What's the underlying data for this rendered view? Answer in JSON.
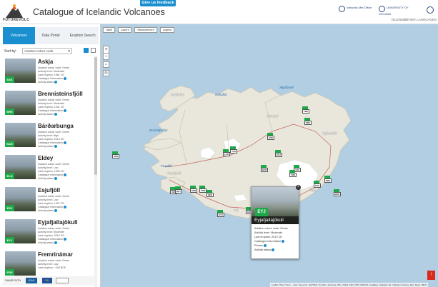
{
  "header": {
    "logo_text": "FUTUREVOLC",
    "title": "Catalogue of Icelandic Volcanoes",
    "feedback_label": "Give us feedback",
    "partner_1": "Icelandic Met Office",
    "partner_2": "UNIVERSITY OF ICELAND",
    "language": "ÍSLENSKA",
    "alt_view": "OTHER LANGUAGES"
  },
  "sidebar": {
    "tabs": [
      "Volcanoes",
      "Data Portal",
      "Eruption Search"
    ],
    "active_tab": "Volcanoes",
    "sort_label": "Sort by:",
    "sort_value": "Aviation colour code",
    "volcanoes": [
      {
        "name": "Askja",
        "code": "ASK",
        "lines": [
          "Aviation colour code: Green",
          "Activity level: Moderate",
          "Last eruption: 1961 CE",
          "Catalogue information",
          "Activity status"
        ]
      },
      {
        "name": "Brennisteinsfjöll",
        "code": "BRE",
        "lines": [
          "Aviation colour code: Green",
          "Activity level: Moderate",
          "Last eruption: 1341 CE",
          "Catalogue information",
          "Activity status"
        ]
      },
      {
        "name": "Bárðarbunga",
        "code": "BAR",
        "lines": [
          "Aviation colour code: Green",
          "Activity level: High",
          "Last eruption: 2014 CE",
          "Catalogue information",
          "Activity status"
        ]
      },
      {
        "name": "Eldey",
        "code": "ELD",
        "lines": [
          "Aviation colour code: Green",
          "Activity level: Low",
          "Last eruption: 1926 CE",
          "Catalogue information",
          "Activity status"
        ]
      },
      {
        "name": "Esjufjöll",
        "code": "ESJ",
        "lines": [
          "Aviation colour code: Green",
          "Activity level: Low",
          "Last eruption: 1927 CE",
          "Catalogue information",
          "Activity status"
        ]
      },
      {
        "name": "Eyjafjallajökull",
        "code": "EYJ",
        "lines": [
          "Aviation colour code: Green",
          "Activity level: Moderate",
          "Last eruption: 2010 CE",
          "Catalogue information",
          "Activity status"
        ]
      },
      {
        "name": "Fremrinámar",
        "code": "FRE",
        "lines": [
          "Aviation colour code: Green",
          "Activity level: Low",
          "Last eruption: ~200 BCE"
        ]
      }
    ],
    "funding": {
      "label_1": "SAMSYNTH",
      "label_2": "ICAO",
      "label_3": "EU"
    }
  },
  "map": {
    "tools": [
      "Table",
      "Layers",
      "Measurement",
      "Legend"
    ],
    "zoom_in": "+",
    "zoom_out": "−",
    "places": [
      "Reykjavík",
      "Akureyri",
      "Ísafjörður",
      "Egilsstaðir",
      "Höfn",
      "Vík"
    ],
    "water_labels": [
      "Faxaflói",
      "Breiðafjörður",
      "Húnaflói",
      "Skjálfandi"
    ],
    "markers": [
      {
        "code": "EYJ"
      },
      {
        "code": "KAT"
      },
      {
        "code": "HEK"
      },
      {
        "code": "TOR"
      },
      {
        "code": "VES"
      },
      {
        "code": "GRI"
      },
      {
        "code": "BAR"
      },
      {
        "code": "ASK"
      },
      {
        "code": "KRA"
      },
      {
        "code": "SNA"
      },
      {
        "code": "LJO"
      },
      {
        "code": "HOF"
      },
      {
        "code": "KVE"
      },
      {
        "code": "ORA"
      },
      {
        "code": "ESJ"
      },
      {
        "code": "TJO"
      },
      {
        "code": "THE"
      },
      {
        "code": "FRE"
      },
      {
        "code": "HEN"
      },
      {
        "code": "REY"
      }
    ],
    "popup": {
      "code": "EYJ",
      "name": "Eyjafjallajökull",
      "lines": [
        "Aviation colour code: Green",
        "Activity level: Moderate",
        "Last eruption: 2010 CE",
        "Catalogue information",
        "Photos",
        "Activity status"
      ]
    },
    "attribution": "Leaflet | Tiles © Esri — Esri, DeLorme, NAVTEQ, TomTom, Intermap, iPC, USGS, FAO, NPS, NRCAN, GeoBase, Kadaster NL, Ordnance Survey, Esri Japan, METI",
    "report_badge": "!"
  },
  "colors": {
    "accent": "#1a8fd0",
    "status_green": "#1fa84a",
    "water": "#b2cee3",
    "land": "#e9e6dc",
    "ice": "#ffffff"
  }
}
